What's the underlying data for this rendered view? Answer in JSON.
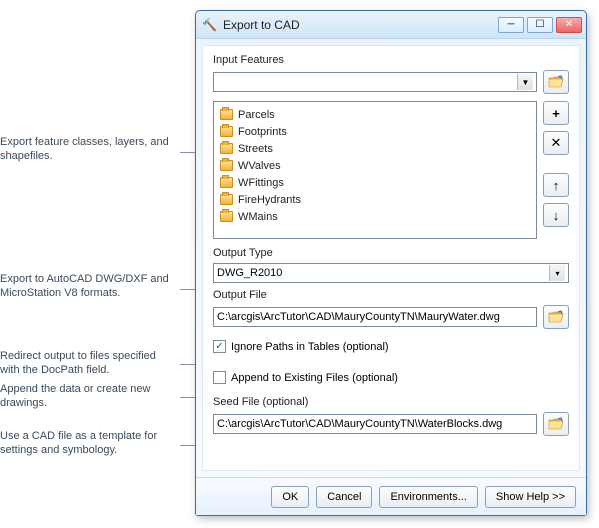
{
  "window": {
    "title": "Export to CAD",
    "min_tip": "Minimize",
    "max_tip": "Maximize",
    "close_tip": "Close"
  },
  "labels": {
    "input_features": "Input Features",
    "output_type": "Output Type",
    "output_file": "Output File",
    "seed_file": "Seed File (optional)",
    "ignore_paths": "Ignore Paths in Tables (optional)",
    "append": "Append to Existing Files (optional)"
  },
  "input_features_value": "",
  "features": [
    "Parcels",
    "Footprints",
    "Streets",
    "WValves",
    "WFittings",
    "FireHydrants",
    "WMains"
  ],
  "output_type_value": "DWG_R2010",
  "output_file_value": "C:\\arcgis\\ArcTutor\\CAD\\MauryCountyTN\\MauryWater.dwg",
  "seed_file_value": "C:\\arcgis\\ArcTutor\\CAD\\MauryCountyTN\\WaterBlocks.dwg",
  "ignore_paths_checked": true,
  "append_checked": false,
  "buttons": {
    "ok": "OK",
    "cancel": "Cancel",
    "env": "Environments...",
    "help": "Show Help >>"
  },
  "sidebtns": {
    "add": "+",
    "remove": "✕",
    "up": "↑",
    "down": "↓"
  },
  "callouts": {
    "c1": "Export feature classes, layers, and shapefiles.",
    "c2": "Export to AutoCAD DWG/DXF and MicroStation V8 formats.",
    "c3": "Redirect output to files specified with the DocPath field.",
    "c4": "Append the data or create new drawings.",
    "c5": "Use a CAD file as a template for settings and symbology."
  }
}
